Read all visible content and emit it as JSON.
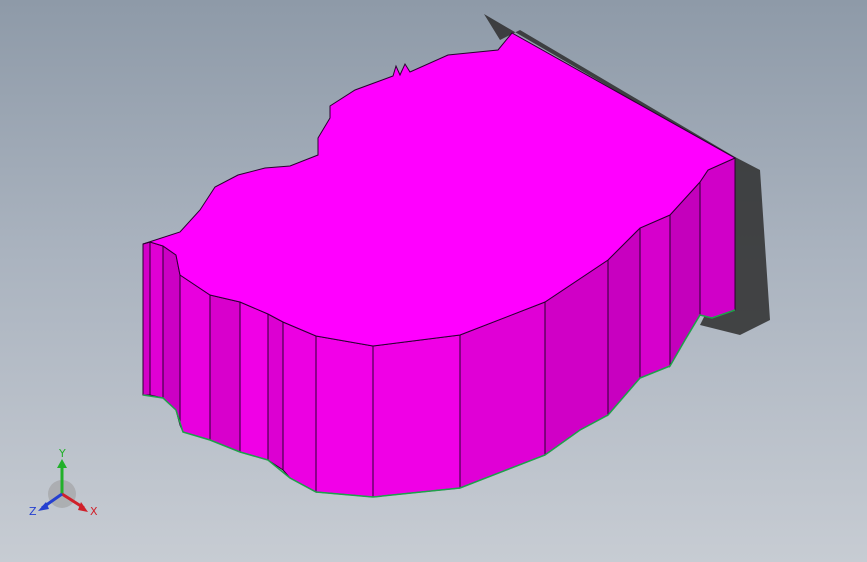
{
  "viewport": {
    "background_top": "#8e9aa8",
    "background_bottom": "#c7ccd3"
  },
  "model": {
    "top_face_color": "#ff00ff",
    "side_face_colors": [
      "#d400c8",
      "#e600dc",
      "#f000e6",
      "#c800c0"
    ],
    "edge_color": "#2a0030",
    "base_edge_color": "#1fa24a",
    "shadow_color": "#2e2e2e"
  },
  "triad": {
    "x_label": "X",
    "y_label": "Y",
    "z_label": "Z",
    "x_color": "#d0202a",
    "y_color": "#22b02a",
    "z_color": "#2540d0"
  }
}
